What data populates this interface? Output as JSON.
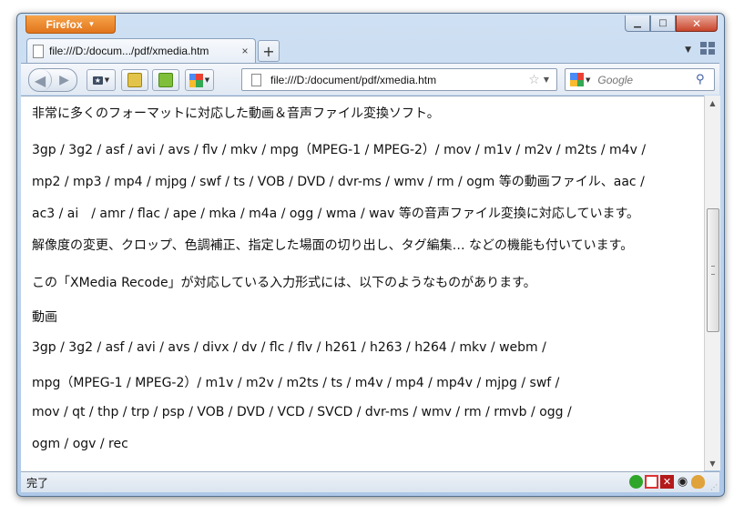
{
  "window": {
    "app_button_label": "Firefox",
    "controls": {
      "minimize": "—",
      "maximize": "▢",
      "close": "✕"
    }
  },
  "tabs": [
    {
      "label": "file:///D:/docum.../pdf/xmedia.htm",
      "close_label": "×"
    }
  ],
  "new_tab_label": "+",
  "navbar": {
    "url": "file:///D:/document/pdf/xmedia.htm",
    "search_placeholder": "Google"
  },
  "content": {
    "lines": [
      "非常に多くのフォーマットに対応した動画＆音声ファイル変換ソフト。",
      "3gp / 3g2 / asf / avi / avs / flv / mkv / mpg（MPEG-1 / MPEG-2）/ mov / m1v / m2v / m2ts / m4v /",
      "mp2 / mp3 / mp4 / mjpg / swf / ts / VOB / DVD / dvr-ms / wmv / rm / ogm 等の動画ファイル、aac /",
      "ac3 / ai　/ amr / flac / ape / mka / m4a / ogg / wma / wav 等の音声ファイル変換に対応しています。",
      "解像度の変更、クロップ、色調補正、指定した場面の切り出し、タグ編集… などの機能も付いています。",
      "この「XMedia Recode」が対応している入力形式には、以下のようなものがあります。",
      "動画",
      "3gp / 3g2 / asf / avi / avs / divx / dv / flc / flv / h261 / h263 / h264 / mkv / webm /",
      "mpg（MPEG-1 / MPEG-2）/ m1v / m2v / m2ts / ts / m4v / mp4 / mp4v / mjpg / swf /",
      "mov / qt / thp / trp / psp / VOB / DVD / VCD / SVCD / dvr-ms / wmv / rm / rmvb / ogg /",
      "ogm / ogv / rec"
    ]
  },
  "statusbar": {
    "text": "完了"
  },
  "colors": {
    "accent": "#e1751c",
    "chrome": "#b9d1ec"
  }
}
